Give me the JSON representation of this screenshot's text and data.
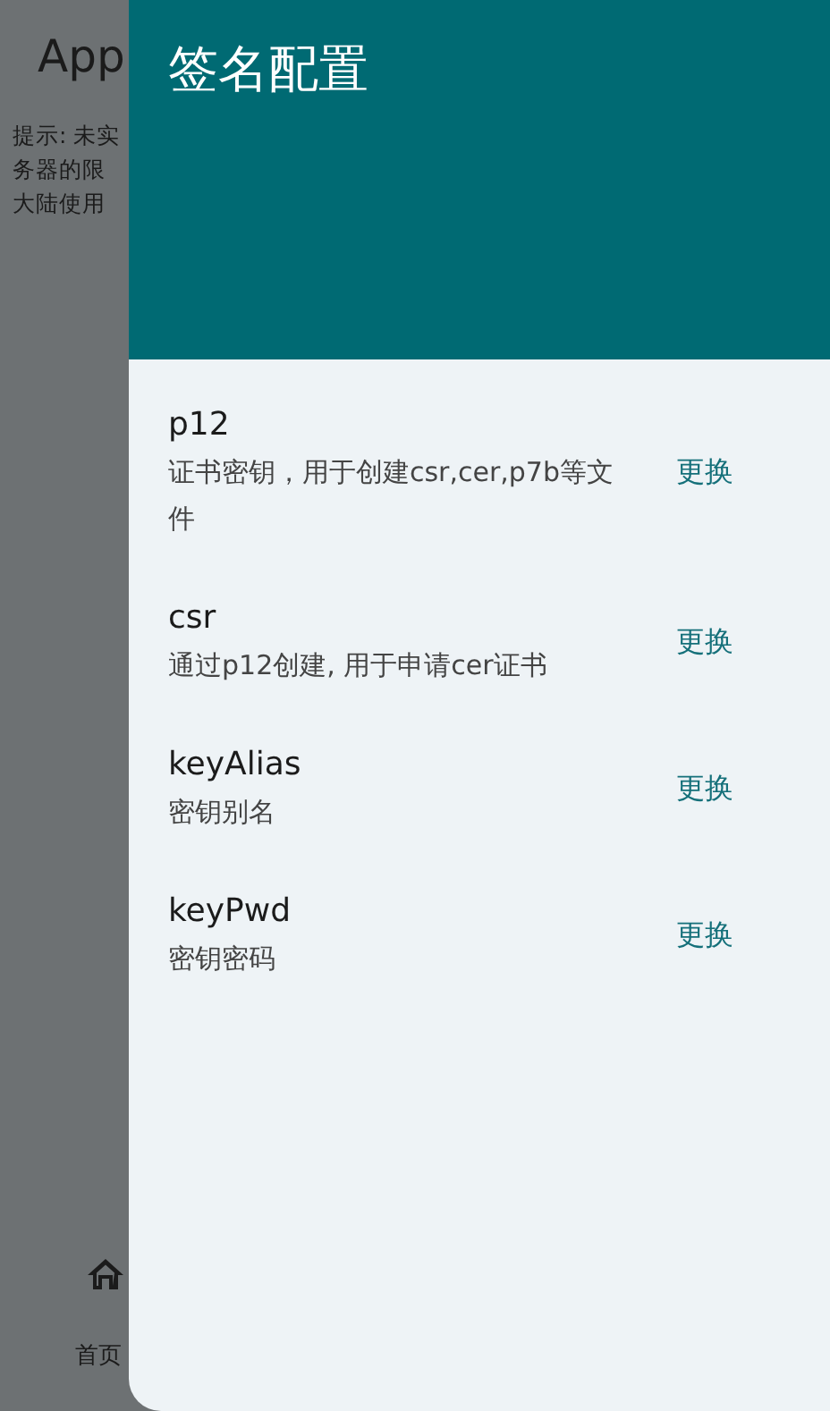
{
  "background_page": {
    "title": "App",
    "hint_lines": [
      "提示: 未实",
      "务器的限",
      "大陆使用"
    ],
    "bottom_nav": [
      {
        "label": "首页",
        "selected": true
      }
    ]
  },
  "drawer": {
    "title": "签名配置",
    "items": [
      {
        "name": "p12",
        "description": "证书密钥，用于创建csr,cer,p7b等文件",
        "action": "更换"
      },
      {
        "name": "csr",
        "description": "通过p12创建, 用于申请cer证书",
        "action": "更换"
      },
      {
        "name": "keyAlias",
        "description": "密钥别名",
        "action": "更换"
      },
      {
        "name": "keyPwd",
        "description": "密钥密码",
        "action": "更换"
      }
    ]
  }
}
